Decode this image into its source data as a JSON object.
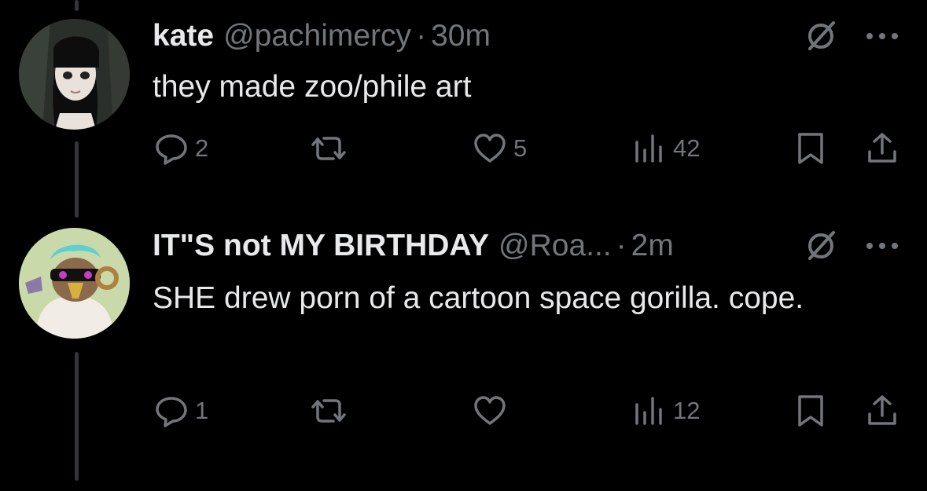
{
  "tweets": [
    {
      "name": "kate",
      "handle": "@pachimercy",
      "separator": "·",
      "time": "30m",
      "text": "they made zoo/phile art",
      "replies": "2",
      "reposts": "",
      "likes": "5",
      "views": "42"
    },
    {
      "name": "IT\"S not MY BIRTHDAY",
      "handle": "@Roa...",
      "separator": "·",
      "time": "2m",
      "text": "SHE drew porn of a cartoon space gorilla. cope.",
      "replies": "1",
      "reposts": "",
      "likes": "",
      "views": "12"
    }
  ],
  "icons": {
    "grok": "grok-icon",
    "more": "more-icon",
    "reply": "reply-icon",
    "repost": "repost-icon",
    "like": "heart-icon",
    "views": "views-icon",
    "bookmark": "bookmark-icon",
    "share": "share-icon"
  },
  "colors": {
    "background": "#000000",
    "primary_text": "#e7e9ea",
    "secondary_text": "#71767b",
    "thread_line": "#333639"
  }
}
